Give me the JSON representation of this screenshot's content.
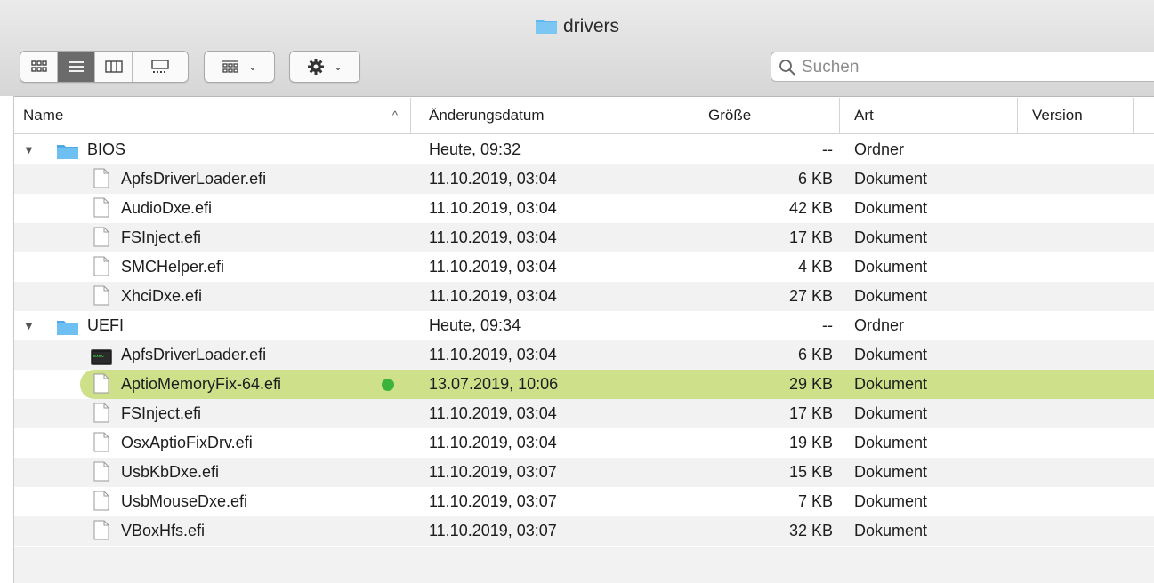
{
  "window": {
    "title": "drivers"
  },
  "toolbar": {
    "view_buttons": [
      "icon-view-icon",
      "list-view-icon",
      "column-view-icon",
      "gallery-view-icon"
    ],
    "group_icon": "group-icon",
    "action_icon": "gear-icon",
    "search_placeholder": "Suchen"
  },
  "columns": {
    "name": "Name",
    "date": "Änderungsdatum",
    "size": "Größe",
    "kind": "Art",
    "version": "Version",
    "sort_indicator": "^"
  },
  "rows": [
    {
      "name": "BIOS",
      "date": "Heute, 09:32",
      "size": "--",
      "kind": "Ordner",
      "type": "folder"
    },
    {
      "name": "ApfsDriverLoader.efi",
      "date": "11.10.2019, 03:04",
      "size": "6 KB",
      "kind": "Dokument",
      "type": "doc"
    },
    {
      "name": "AudioDxe.efi",
      "date": "11.10.2019, 03:04",
      "size": "42 KB",
      "kind": "Dokument",
      "type": "doc"
    },
    {
      "name": "FSInject.efi",
      "date": "11.10.2019, 03:04",
      "size": "17 KB",
      "kind": "Dokument",
      "type": "doc"
    },
    {
      "name": "SMCHelper.efi",
      "date": "11.10.2019, 03:04",
      "size": "4 KB",
      "kind": "Dokument",
      "type": "doc"
    },
    {
      "name": "XhciDxe.efi",
      "date": "11.10.2019, 03:04",
      "size": "27 KB",
      "kind": "Dokument",
      "type": "doc"
    },
    {
      "name": "UEFI",
      "date": "Heute, 09:34",
      "size": "--",
      "kind": "Ordner",
      "type": "folder"
    },
    {
      "name": "ApfsDriverLoader.efi",
      "date": "11.10.2019, 03:04",
      "size": "6 KB",
      "kind": "Dokument",
      "type": "exec"
    },
    {
      "name": "AptioMemoryFix-64.efi",
      "date": "13.07.2019, 10:06",
      "size": "29 KB",
      "kind": "Dokument",
      "type": "doc",
      "selected": true,
      "tag_color": "#3cb43c"
    },
    {
      "name": "FSInject.efi",
      "date": "11.10.2019, 03:04",
      "size": "17 KB",
      "kind": "Dokument",
      "type": "doc"
    },
    {
      "name": "OsxAptioFixDrv.efi",
      "date": "11.10.2019, 03:04",
      "size": "19 KB",
      "kind": "Dokument",
      "type": "doc"
    },
    {
      "name": "UsbKbDxe.efi",
      "date": "11.10.2019, 03:07",
      "size": "15 KB",
      "kind": "Dokument",
      "type": "doc"
    },
    {
      "name": "UsbMouseDxe.efi",
      "date": "11.10.2019, 03:07",
      "size": "7 KB",
      "kind": "Dokument",
      "type": "doc"
    },
    {
      "name": "VBoxHfs.efi",
      "date": "11.10.2019, 03:07",
      "size": "32 KB",
      "kind": "Dokument",
      "type": "doc"
    }
  ],
  "colors": {
    "selection": "#cfe08a",
    "folder": "#5fb8ef",
    "stripe": "#f2f2f2"
  }
}
